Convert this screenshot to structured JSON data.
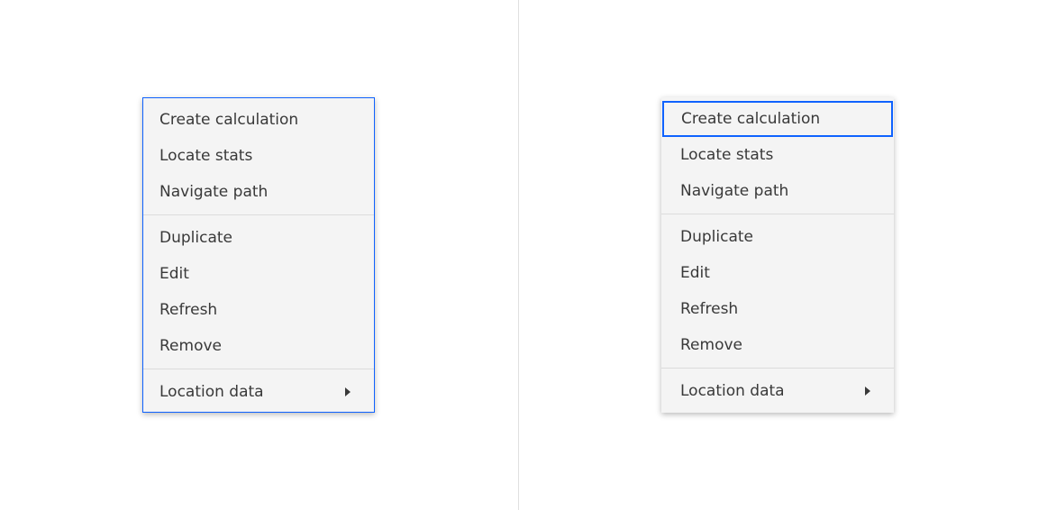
{
  "colors": {
    "focus": "#0f62fe",
    "menu_bg": "#f4f4f4",
    "text": "#393939"
  },
  "menus": [
    {
      "variant": "menu-focused",
      "groups": [
        [
          "Create calculation",
          "Locate stats",
          "Navigate path"
        ],
        [
          "Duplicate",
          "Edit",
          "Refresh",
          "Remove"
        ],
        [
          "Location data"
        ]
      ],
      "submenu_item": "Location data"
    },
    {
      "variant": "item-focused",
      "focused_item": "Create calculation",
      "groups": [
        [
          "Create calculation",
          "Locate stats",
          "Navigate path"
        ],
        [
          "Duplicate",
          "Edit",
          "Refresh",
          "Remove"
        ],
        [
          "Location data"
        ]
      ],
      "submenu_item": "Location data"
    }
  ]
}
